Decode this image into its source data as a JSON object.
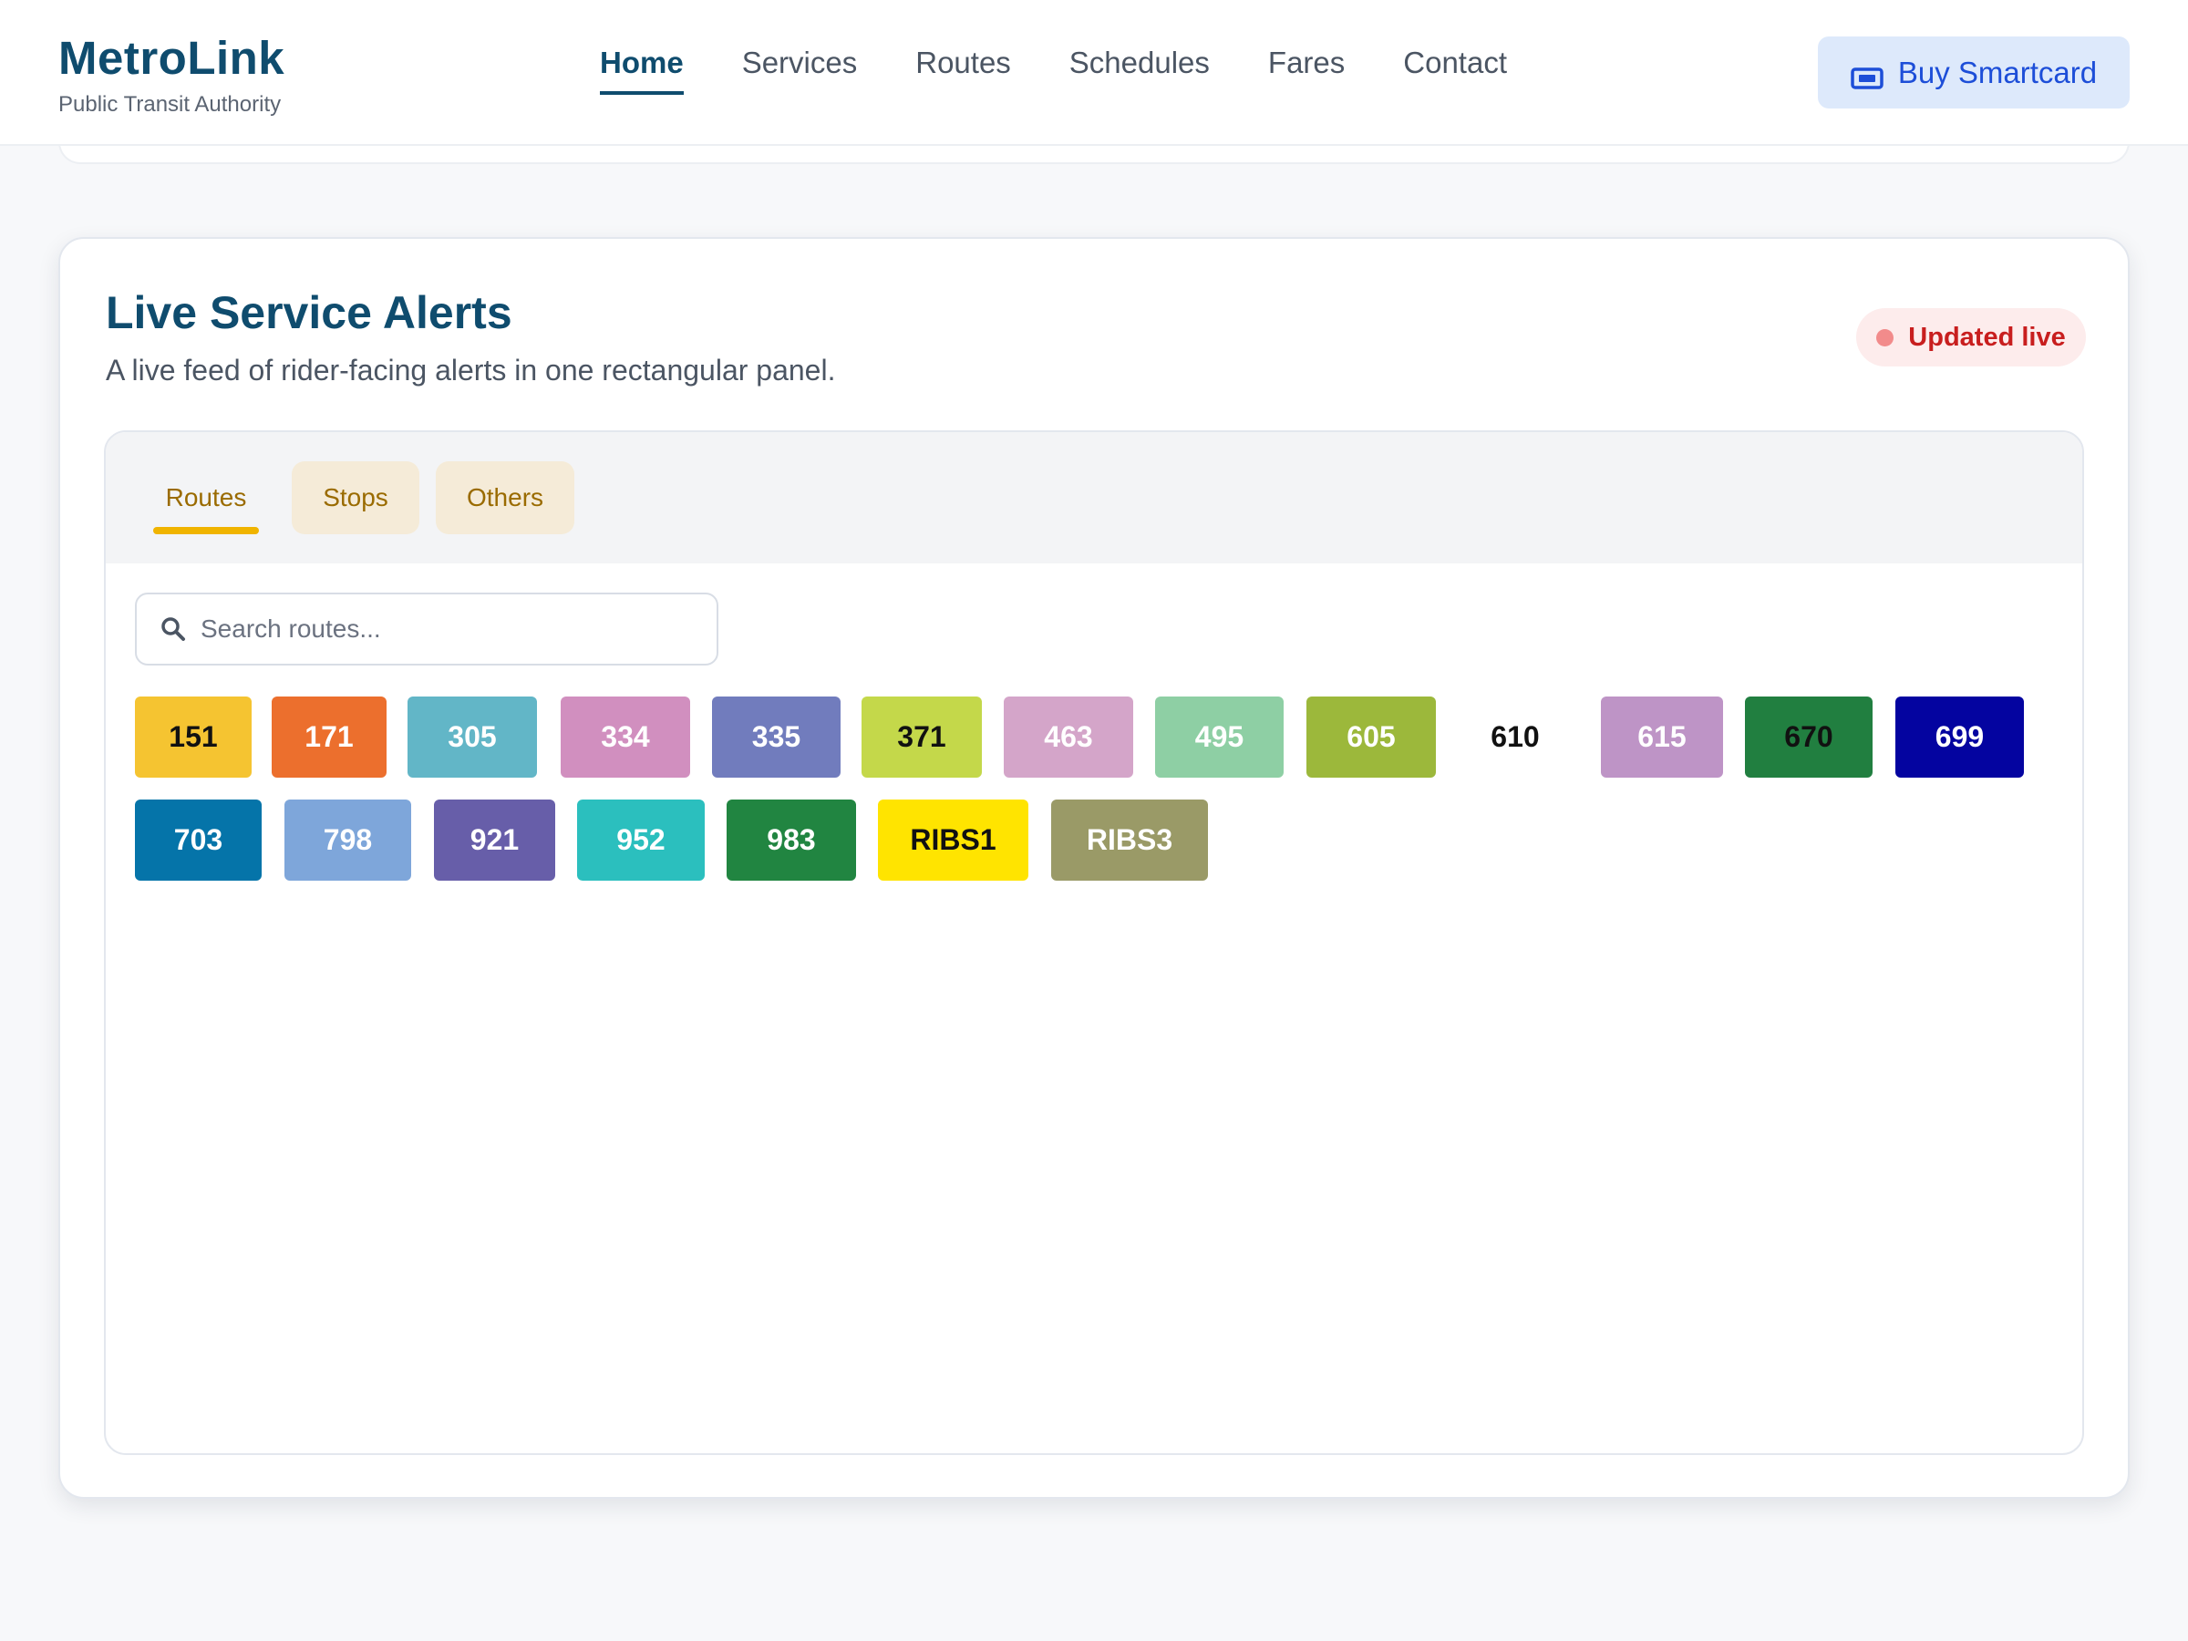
{
  "brand": {
    "name": "MetroLink",
    "tagline": "Public Transit Authority"
  },
  "nav": {
    "items": [
      {
        "label": "Home",
        "active": true
      },
      {
        "label": "Services"
      },
      {
        "label": "Routes"
      },
      {
        "label": "Schedules"
      },
      {
        "label": "Fares"
      },
      {
        "label": "Contact"
      }
    ],
    "cta_label": "Buy Smartcard",
    "cta_icon": "ticket-icon"
  },
  "alerts": {
    "title": "Live Service Alerts",
    "subtitle": "A live feed of rider-facing alerts in one rectangular panel.",
    "live_badge": "Updated live",
    "tabs": [
      {
        "label": "Routes",
        "active": true
      },
      {
        "label": "Stops"
      },
      {
        "label": "Others"
      }
    ],
    "search_placeholder": "Search routes...",
    "routes": [
      {
        "label": "151",
        "bg": "#f5c431",
        "fg": "#111111"
      },
      {
        "label": "171",
        "bg": "#ec6f2d",
        "fg": "#ffffff"
      },
      {
        "label": "305",
        "bg": "#62b6c7",
        "fg": "#ffffff"
      },
      {
        "label": "334",
        "bg": "#d18fbf",
        "fg": "#ffffff"
      },
      {
        "label": "335",
        "bg": "#717cbd",
        "fg": "#ffffff"
      },
      {
        "label": "371",
        "bg": "#c4d84a",
        "fg": "#111111"
      },
      {
        "label": "463",
        "bg": "#d4a5c9",
        "fg": "#ffffff"
      },
      {
        "label": "495",
        "bg": "#8ecfa4",
        "fg": "#ffffff"
      },
      {
        "label": "605",
        "bg": "#9cb83b",
        "fg": "#ffffff"
      },
      {
        "label": "610",
        "bg": "#ffffff",
        "fg": "#111111"
      },
      {
        "label": "615",
        "bg": "#be94c6",
        "fg": "#ffffff"
      },
      {
        "label": "670",
        "bg": "#217f40",
        "fg": "#111111"
      },
      {
        "label": "699",
        "bg": "#0404a0",
        "fg": "#ffffff"
      },
      {
        "label": "703",
        "bg": "#0574a9",
        "fg": "#ffffff"
      },
      {
        "label": "798",
        "bg": "#7ea6da",
        "fg": "#ffffff"
      },
      {
        "label": "921",
        "bg": "#675ea9",
        "fg": "#ffffff"
      },
      {
        "label": "952",
        "bg": "#2bbfbe",
        "fg": "#ffffff"
      },
      {
        "label": "983",
        "bg": "#218541",
        "fg": "#ffffff"
      },
      {
        "label": "RIBS1",
        "bg": "#ffe400",
        "fg": "#111111"
      },
      {
        "label": "RIBS3",
        "bg": "#9a9a67",
        "fg": "#ffffff"
      }
    ]
  }
}
